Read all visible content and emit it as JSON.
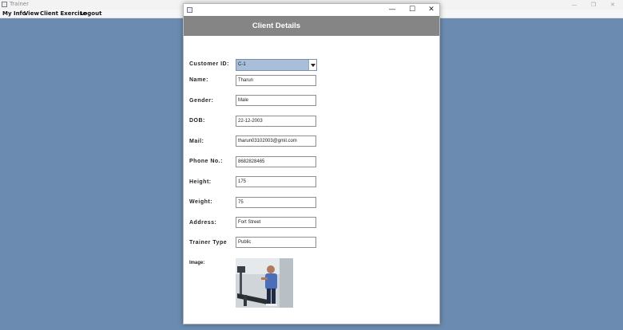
{
  "app": {
    "title": "Trainer",
    "controls": {
      "minimize": "—",
      "restore": "❐",
      "close": "✕"
    }
  },
  "menu": {
    "items": [
      "My Info",
      "View",
      "Client Exercise",
      "Logout"
    ]
  },
  "dialog": {
    "controls": {
      "minimize": "—",
      "maximize": "☐",
      "close": "✕"
    },
    "header_title": "Client Details",
    "customer_id": {
      "label": "Customer ID:",
      "value": "C-1"
    },
    "fields": [
      {
        "label": "Name:",
        "value": "Tharun"
      },
      {
        "label": "Gender:",
        "value": "Male"
      },
      {
        "label": "DOB:",
        "value": "22-12-2003"
      },
      {
        "label": "Mail:",
        "value": "tharun03102003@gmil.com"
      },
      {
        "label": "Phone No.:",
        "value": "8682828465"
      },
      {
        "label": "Height:",
        "value": "175"
      },
      {
        "label": "Weight:",
        "value": "75"
      },
      {
        "label": "Address:",
        "value": "Fort Street"
      },
      {
        "label": "Trainer Type",
        "value": "Public"
      }
    ],
    "image_label": "Image:"
  },
  "colors": {
    "desktop": "#6b8bb0",
    "header": "#858585",
    "combo": "#a9bfd9"
  }
}
